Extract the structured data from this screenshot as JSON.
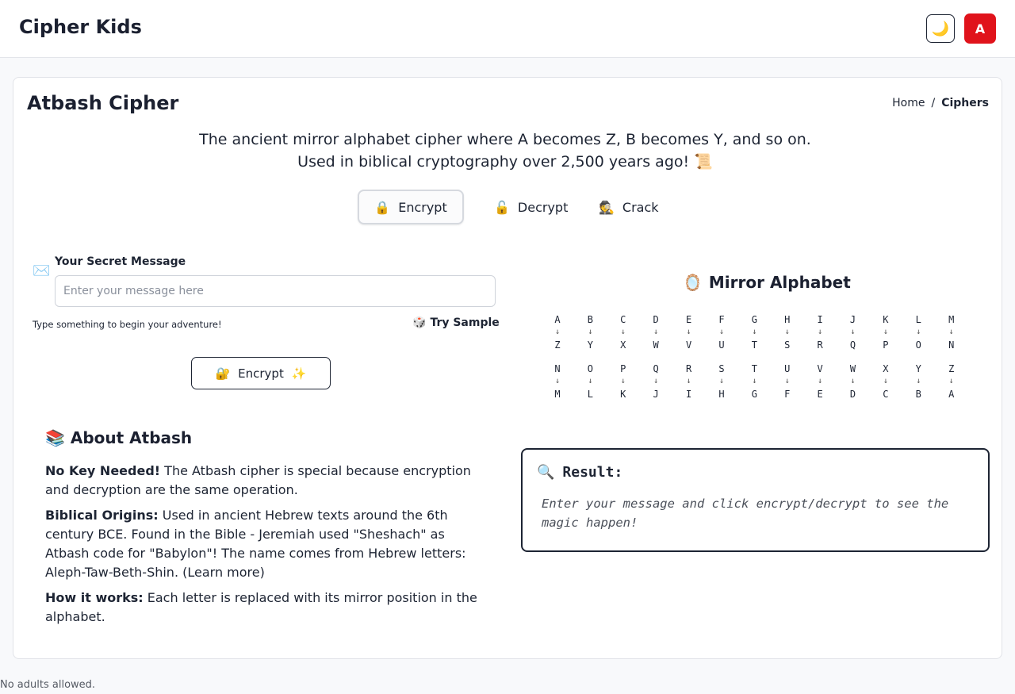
{
  "header": {
    "brand": "Cipher Kids",
    "theme_icon": "🌙",
    "avatar_initial": "A"
  },
  "page": {
    "title": "Atbash Cipher",
    "breadcrumb": {
      "home": "Home",
      "separator": "/",
      "current": "Ciphers"
    },
    "description": "The ancient mirror alphabet cipher where A becomes Z, B becomes Y, and so on. Used in biblical cryptography over 2,500 years ago! 📜"
  },
  "tabs": [
    {
      "icon": "🔒",
      "label": "Encrypt",
      "active": true
    },
    {
      "icon": "🔓",
      "label": "Decrypt",
      "active": false
    },
    {
      "icon": "🕵️",
      "label": "Crack",
      "active": false
    }
  ],
  "form": {
    "icon": "✉️",
    "label": "Your Secret Message",
    "value": "",
    "placeholder": "Enter your message here",
    "hint": "Type something to begin your adventure!",
    "try_sample_icon": "🎲",
    "try_sample_label": "Try Sample",
    "encrypt_icon": "🔐",
    "encrypt_label": "Encrypt",
    "encrypt_suffix_icon": "✨"
  },
  "about": {
    "title": "📚 About Atbash",
    "items": [
      {
        "heading": "No Key Needed!",
        "text": " The Atbash cipher is special because encryption and decryption are the same operation."
      },
      {
        "heading": "Biblical Origins:",
        "text": " Used in ancient Hebrew texts around the 6th century BCE. Found in the Bible - Jeremiah used \"Sheshach\" as Atbash code for \"Babylon\"! The name comes from Hebrew letters: Aleph-Taw-Beth-Shin. (Learn more)"
      },
      {
        "heading": "How it works:",
        "text": " Each letter is replaced with its mirror position in the alphabet."
      }
    ]
  },
  "mirror": {
    "icon": "🪞",
    "title": "Mirror Alphabet",
    "arrow": "↓",
    "rows": [
      [
        [
          "A",
          "Z"
        ],
        [
          "B",
          "Y"
        ],
        [
          "C",
          "X"
        ],
        [
          "D",
          "W"
        ],
        [
          "E",
          "V"
        ],
        [
          "F",
          "U"
        ],
        [
          "G",
          "T"
        ],
        [
          "H",
          "S"
        ],
        [
          "I",
          "R"
        ],
        [
          "J",
          "Q"
        ],
        [
          "K",
          "P"
        ],
        [
          "L",
          "O"
        ],
        [
          "M",
          "N"
        ]
      ],
      [
        [
          "N",
          "M"
        ],
        [
          "O",
          "L"
        ],
        [
          "P",
          "K"
        ],
        [
          "Q",
          "J"
        ],
        [
          "R",
          "I"
        ],
        [
          "S",
          "H"
        ],
        [
          "T",
          "G"
        ],
        [
          "U",
          "F"
        ],
        [
          "V",
          "E"
        ],
        [
          "W",
          "D"
        ],
        [
          "X",
          "C"
        ],
        [
          "Y",
          "B"
        ],
        [
          "Z",
          "A"
        ]
      ]
    ]
  },
  "result": {
    "icon": "🔍",
    "title": "Result:",
    "placeholder": "Enter your message and click encrypt/decrypt to see the magic happen!"
  },
  "footer": {
    "text": "No adults allowed."
  }
}
